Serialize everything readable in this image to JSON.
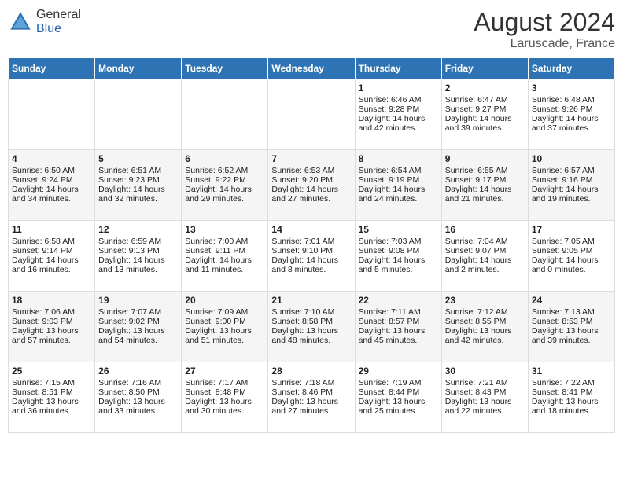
{
  "header": {
    "logo_general": "General",
    "logo_blue": "Blue",
    "month_year": "August 2024",
    "location": "Laruscade, France"
  },
  "days_of_week": [
    "Sunday",
    "Monday",
    "Tuesday",
    "Wednesday",
    "Thursday",
    "Friday",
    "Saturday"
  ],
  "weeks": [
    [
      {
        "day": "",
        "content": ""
      },
      {
        "day": "",
        "content": ""
      },
      {
        "day": "",
        "content": ""
      },
      {
        "day": "",
        "content": ""
      },
      {
        "day": "1",
        "content": "Sunrise: 6:46 AM\nSunset: 9:28 PM\nDaylight: 14 hours and 42 minutes."
      },
      {
        "day": "2",
        "content": "Sunrise: 6:47 AM\nSunset: 9:27 PM\nDaylight: 14 hours and 39 minutes."
      },
      {
        "day": "3",
        "content": "Sunrise: 6:48 AM\nSunset: 9:26 PM\nDaylight: 14 hours and 37 minutes."
      }
    ],
    [
      {
        "day": "4",
        "content": "Sunrise: 6:50 AM\nSunset: 9:24 PM\nDaylight: 14 hours and 34 minutes."
      },
      {
        "day": "5",
        "content": "Sunrise: 6:51 AM\nSunset: 9:23 PM\nDaylight: 14 hours and 32 minutes."
      },
      {
        "day": "6",
        "content": "Sunrise: 6:52 AM\nSunset: 9:22 PM\nDaylight: 14 hours and 29 minutes."
      },
      {
        "day": "7",
        "content": "Sunrise: 6:53 AM\nSunset: 9:20 PM\nDaylight: 14 hours and 27 minutes."
      },
      {
        "day": "8",
        "content": "Sunrise: 6:54 AM\nSunset: 9:19 PM\nDaylight: 14 hours and 24 minutes."
      },
      {
        "day": "9",
        "content": "Sunrise: 6:55 AM\nSunset: 9:17 PM\nDaylight: 14 hours and 21 minutes."
      },
      {
        "day": "10",
        "content": "Sunrise: 6:57 AM\nSunset: 9:16 PM\nDaylight: 14 hours and 19 minutes."
      }
    ],
    [
      {
        "day": "11",
        "content": "Sunrise: 6:58 AM\nSunset: 9:14 PM\nDaylight: 14 hours and 16 minutes."
      },
      {
        "day": "12",
        "content": "Sunrise: 6:59 AM\nSunset: 9:13 PM\nDaylight: 14 hours and 13 minutes."
      },
      {
        "day": "13",
        "content": "Sunrise: 7:00 AM\nSunset: 9:11 PM\nDaylight: 14 hours and 11 minutes."
      },
      {
        "day": "14",
        "content": "Sunrise: 7:01 AM\nSunset: 9:10 PM\nDaylight: 14 hours and 8 minutes."
      },
      {
        "day": "15",
        "content": "Sunrise: 7:03 AM\nSunset: 9:08 PM\nDaylight: 14 hours and 5 minutes."
      },
      {
        "day": "16",
        "content": "Sunrise: 7:04 AM\nSunset: 9:07 PM\nDaylight: 14 hours and 2 minutes."
      },
      {
        "day": "17",
        "content": "Sunrise: 7:05 AM\nSunset: 9:05 PM\nDaylight: 14 hours and 0 minutes."
      }
    ],
    [
      {
        "day": "18",
        "content": "Sunrise: 7:06 AM\nSunset: 9:03 PM\nDaylight: 13 hours and 57 minutes."
      },
      {
        "day": "19",
        "content": "Sunrise: 7:07 AM\nSunset: 9:02 PM\nDaylight: 13 hours and 54 minutes."
      },
      {
        "day": "20",
        "content": "Sunrise: 7:09 AM\nSunset: 9:00 PM\nDaylight: 13 hours and 51 minutes."
      },
      {
        "day": "21",
        "content": "Sunrise: 7:10 AM\nSunset: 8:58 PM\nDaylight: 13 hours and 48 minutes."
      },
      {
        "day": "22",
        "content": "Sunrise: 7:11 AM\nSunset: 8:57 PM\nDaylight: 13 hours and 45 minutes."
      },
      {
        "day": "23",
        "content": "Sunrise: 7:12 AM\nSunset: 8:55 PM\nDaylight: 13 hours and 42 minutes."
      },
      {
        "day": "24",
        "content": "Sunrise: 7:13 AM\nSunset: 8:53 PM\nDaylight: 13 hours and 39 minutes."
      }
    ],
    [
      {
        "day": "25",
        "content": "Sunrise: 7:15 AM\nSunset: 8:51 PM\nDaylight: 13 hours and 36 minutes."
      },
      {
        "day": "26",
        "content": "Sunrise: 7:16 AM\nSunset: 8:50 PM\nDaylight: 13 hours and 33 minutes."
      },
      {
        "day": "27",
        "content": "Sunrise: 7:17 AM\nSunset: 8:48 PM\nDaylight: 13 hours and 30 minutes."
      },
      {
        "day": "28",
        "content": "Sunrise: 7:18 AM\nSunset: 8:46 PM\nDaylight: 13 hours and 27 minutes."
      },
      {
        "day": "29",
        "content": "Sunrise: 7:19 AM\nSunset: 8:44 PM\nDaylight: 13 hours and 25 minutes."
      },
      {
        "day": "30",
        "content": "Sunrise: 7:21 AM\nSunset: 8:43 PM\nDaylight: 13 hours and 22 minutes."
      },
      {
        "day": "31",
        "content": "Sunrise: 7:22 AM\nSunset: 8:41 PM\nDaylight: 13 hours and 18 minutes."
      }
    ]
  ]
}
